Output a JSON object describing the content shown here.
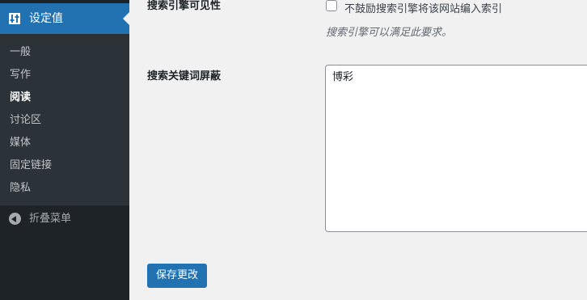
{
  "sidebar": {
    "settings_header": {
      "label": "设定值",
      "icon": "settings-sliders-icon"
    },
    "items": [
      {
        "label": "一般",
        "current": false
      },
      {
        "label": "写作",
        "current": false
      },
      {
        "label": "阅读",
        "current": true
      },
      {
        "label": "讨论区",
        "current": false
      },
      {
        "label": "媒体",
        "current": false
      },
      {
        "label": "固定链接",
        "current": false
      },
      {
        "label": "隐私",
        "current": false
      }
    ],
    "collapse": {
      "label": "折叠菜单",
      "icon": "collapse-arrow-icon"
    }
  },
  "main": {
    "search_visibility": {
      "label": "搜索引擎可见性",
      "checkbox_label": "不鼓励搜索引擎将该网站编入索引",
      "checked": false,
      "description": "搜索引擎可以满足此要求。"
    },
    "keyword_block": {
      "label": "搜索关键词屏蔽",
      "value": "博彩"
    },
    "save_label": "保存更改"
  },
  "colors": {
    "sidebar_bg": "#1d2327",
    "submenu_bg": "#2c3338",
    "accent": "#2271b1",
    "page_bg": "#f1f1f1"
  }
}
